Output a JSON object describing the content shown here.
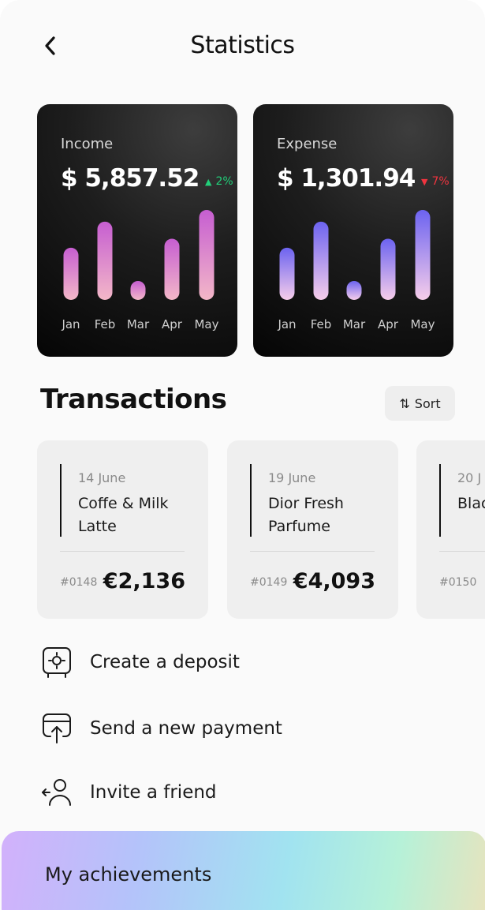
{
  "header": {
    "title": "Statistics",
    "back_icon": "chevron-left-icon"
  },
  "stats": {
    "income": {
      "label": "Income",
      "amount": "$ 5,857.52",
      "change": "2%",
      "change_direction": "up",
      "change_color": "#22d07a",
      "bar_gradient": [
        "#f3b7c8",
        "#c65ed1"
      ],
      "chart_data": {
        "type": "bar",
        "categories": [
          "Jan",
          "Feb",
          "Mar",
          "Apr",
          "May"
        ],
        "values": [
          0.58,
          0.87,
          0.21,
          0.68,
          1.0
        ]
      }
    },
    "expense": {
      "label": "Expense",
      "amount": "$ 1,301.94",
      "change": "7%",
      "change_direction": "down",
      "change_color": "#f0343f",
      "bar_gradient": [
        "#f6cdea",
        "#6c63f0"
      ],
      "chart_data": {
        "type": "bar",
        "categories": [
          "Jan",
          "Feb",
          "Mar",
          "Apr",
          "May"
        ],
        "values": [
          0.58,
          0.87,
          0.21,
          0.68,
          1.0
        ]
      }
    }
  },
  "transactions": {
    "title": "Transactions",
    "sort_label": "Sort",
    "items": [
      {
        "date": "14 June",
        "name": "Coffe & Milk Latte",
        "id": "#0148",
        "amount": "€2,136"
      },
      {
        "date": "19 June",
        "name": "Dior Fresh Parfume",
        "id": "#0149",
        "amount": "€4,093"
      },
      {
        "date": "20 J",
        "name": "Blac and",
        "id": "#0150",
        "amount": ""
      }
    ]
  },
  "actions": [
    {
      "label": "Create a deposit",
      "icon": "safe-icon"
    },
    {
      "label": "Send a new payment",
      "icon": "send-payment-icon"
    },
    {
      "label": "Invite a friend",
      "icon": "invite-friend-icon"
    }
  ],
  "achievements": {
    "label": "My achievements"
  }
}
